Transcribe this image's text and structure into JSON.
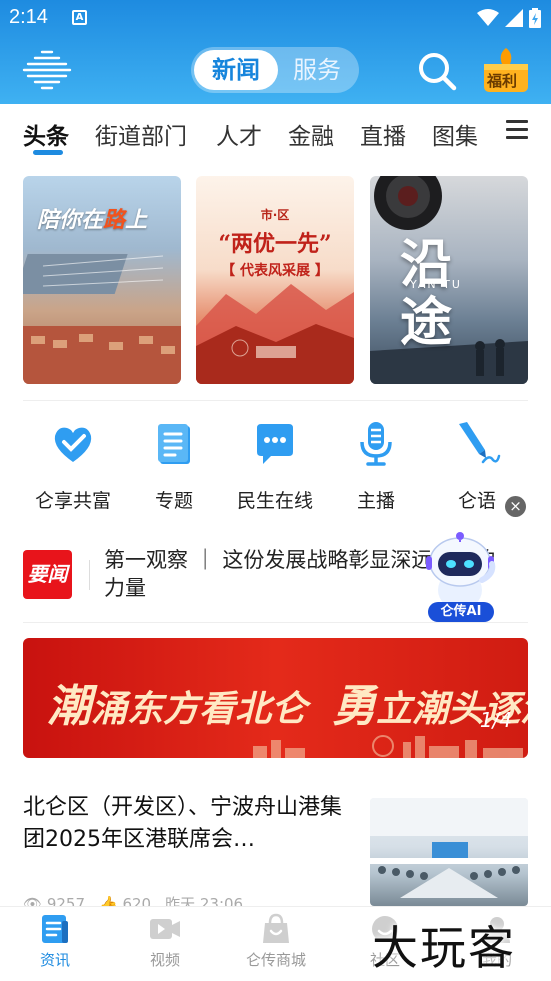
{
  "status_bar": {
    "time": "2:14",
    "notification_icon": "A"
  },
  "header": {
    "tabs": [
      {
        "label": "新闻",
        "active": true
      },
      {
        "label": "服务",
        "active": false
      }
    ],
    "welfare_label": "福利",
    "colors": {
      "primary": "#1e8be0",
      "accent_red": "#e8141b"
    }
  },
  "categories": [
    {
      "label": "头条",
      "active": true
    },
    {
      "label": "街道部门"
    },
    {
      "label": "人才"
    },
    {
      "label": "金融"
    },
    {
      "label": "直播"
    },
    {
      "label": "图集"
    }
  ],
  "banners": [
    {
      "title_a": "陪你在",
      "title_b": "路",
      "title_c": "上"
    },
    {
      "line1": "市·区",
      "line2": "“两优一先”",
      "line3": "【 代表风采展 】"
    },
    {
      "big_a": "沿",
      "big_b": "途",
      "small": "YAN TU"
    }
  ],
  "quick_access": [
    {
      "label": "仑享共富",
      "icon": "heart-check-icon"
    },
    {
      "label": "专题",
      "icon": "document-icon"
    },
    {
      "label": "民生在线",
      "icon": "chat-bubble-icon"
    },
    {
      "label": "主播",
      "icon": "microphone-icon"
    },
    {
      "label": "仑语",
      "icon": "pen-icon"
    }
  ],
  "news_flash": {
    "badge": "要闻",
    "text": "第一观察 ｜ 这份发展战略彰显深远持久的力量",
    "assistant_label": "仑传AI"
  },
  "carousel": {
    "part1_big": "潮",
    "part1": "涌东方看北仑",
    "part2_big": "勇",
    "part2": "立潮头逐浪高",
    "page_indicator": "1/4"
  },
  "article": {
    "title": "北仑区（开发区）、宁波舟山港集团2025年区港联席会…",
    "views": "9257",
    "likes": "620",
    "time": "昨天 23:06"
  },
  "tabbar": [
    {
      "label": "资讯",
      "active": true
    },
    {
      "label": "视频"
    },
    {
      "label": "仑传商城"
    },
    {
      "label": "社区"
    },
    {
      "label": "我的"
    }
  ],
  "watermark": "大玩客"
}
